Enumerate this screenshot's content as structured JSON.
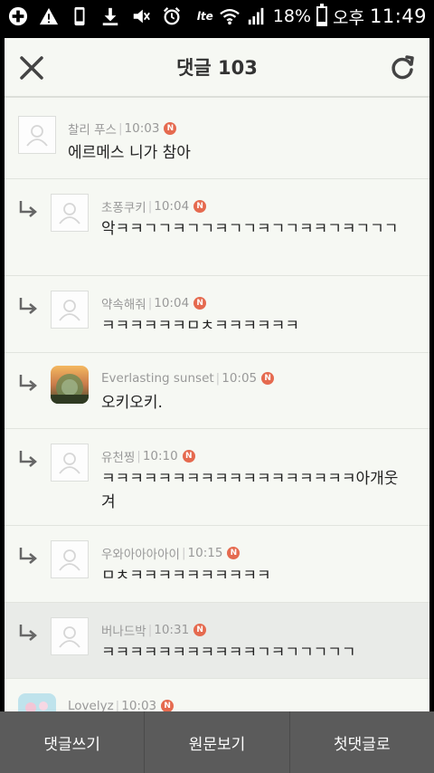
{
  "status": {
    "lte": "lte",
    "battery_pct": "18%",
    "battery_level": 0.18,
    "ampm": "오후",
    "time": "11:49"
  },
  "header": {
    "title": "댓글 103"
  },
  "comments": [
    {
      "author": "찰리 푸스",
      "time": "10:03",
      "badge": "N",
      "text": "에르메스 니가 참아",
      "reply": false,
      "avatar": "person-icon"
    },
    {
      "author": "초퐁쿠키",
      "time": "10:04",
      "badge": "N",
      "text": "악ㅋㅋㄱㄱㅋㄱㄱㅋㄱㄱㅋㄱㄱㅋㅋㄱㅋㄱㄱㄱ",
      "reply": true,
      "avatar": "person-icon"
    },
    {
      "author": "약속해줘",
      "time": "10:04",
      "badge": "N",
      "text": "ㅋㅋㅋㅋㅋㅋㅁㅊㅋㅋㅋㅋㅋㅋ",
      "reply": true,
      "avatar": "person-icon"
    },
    {
      "author": "Everlasting sunset",
      "time": "10:05",
      "badge": "N",
      "text": "오키오키.",
      "reply": true,
      "avatar": "sunset-photo"
    },
    {
      "author": "유천찡",
      "time": "10:10",
      "badge": "N",
      "text": "ㅋㅋㅋㅋㅋㅋㅋㅋㅋㅋㅋㅋㅋㅋㅋㅋㅋㅋ아개웃겨",
      "reply": true,
      "avatar": "person-icon"
    },
    {
      "author": "우와아아아아이",
      "time": "10:15",
      "badge": "N",
      "text": "ㅁㅊㅋㅋㅋㅋㅋㅋㅋㅋㅋㅋ",
      "reply": true,
      "avatar": "person-icon"
    },
    {
      "author": "버나드박",
      "time": "10:31",
      "badge": "N",
      "text": "ㅋㅋㅋㅋㅋㅋㅋㅋㅋㅋㅋㄱㅋㄱㄱㄱㄱㄱ",
      "reply": true,
      "avatar": "person-icon"
    },
    {
      "author": "Lovelyz",
      "time": "10:03",
      "badge": "N",
      "text": "",
      "reply": false,
      "avatar": "lovelyz-photo"
    }
  ],
  "bottombar": {
    "write": "댓글쓰기",
    "original": "원문보기",
    "first": "첫댓글로"
  },
  "colors": {
    "background": "#f6f8f3",
    "badge": "#e56a4f",
    "bottombar": "#5b5b5b"
  }
}
